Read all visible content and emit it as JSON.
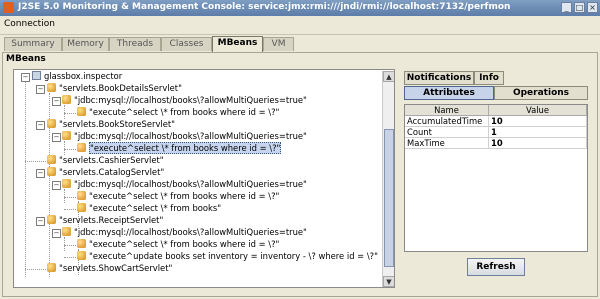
{
  "window": {
    "title": "J2SE 5.0 Monitoring & Management Console: service:jmx:rmi:///jndi/rmi://localhost:7132/perfmon"
  },
  "menu": {
    "items": [
      "Connection"
    ]
  },
  "tabs": [
    "Summary",
    "Memory",
    "Threads",
    "Classes",
    "MBeans",
    "VM"
  ],
  "active_tab": "MBeans",
  "section_label": "MBeans",
  "tree": {
    "root": "glassbox.inspector",
    "items": [
      "\"servlets.BookDetailsServlet\"",
      "\"jdbc:mysql://localhost/books\\?allowMultiQueries=true\"",
      "\"execute^select \\* from books where id = \\?\"",
      "\"servlets.BookStoreServlet\"",
      "\"jdbc:mysql://localhost/books\\?allowMultiQueries=true\"",
      "\"execute^select \\* from books where id = \\?\"",
      "\"servlets.CashierServlet\"",
      "\"servlets.CatalogServlet\"",
      "\"jdbc:mysql://localhost/books\\?allowMultiQueries=true\"",
      "\"execute^select \\* from books where id = \\?\"",
      "\"execute^select \\* from books\"",
      "\"servlets.ReceiptServlet\"",
      "\"jdbc:mysql://localhost/books\\?allowMultiQueries=true\"",
      "\"execute^select \\* from books where id = \\?\"",
      "\"execute^update books set inventory = inventory - \\? where id = \\?\"",
      "\"servlets.ShowCartServlet\""
    ]
  },
  "details": {
    "top_tabs": [
      "Notifications",
      "Info"
    ],
    "sub_tabs": [
      "Attributes",
      "Operations"
    ],
    "active_sub_tab": "Attributes",
    "table": {
      "headers": [
        "Name",
        "Value"
      ],
      "rows": [
        [
          "AccumulatedTime",
          "10"
        ],
        [
          "Count",
          "1"
        ],
        [
          "MaxTime",
          "10"
        ]
      ]
    },
    "refresh_label": "Refresh"
  }
}
